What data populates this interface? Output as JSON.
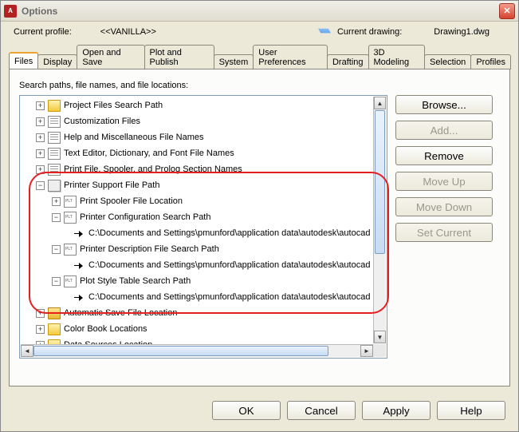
{
  "window": {
    "title": "Options"
  },
  "profile": {
    "label": "Current profile:",
    "value": "<<VANILLA>>"
  },
  "drawing": {
    "label": "Current drawing:",
    "value": "Drawing1.dwg"
  },
  "tabs": [
    "Files",
    "Display",
    "Open and Save",
    "Plot and Publish",
    "System",
    "User Preferences",
    "Drafting",
    "3D Modeling",
    "Selection",
    "Profiles"
  ],
  "panel_caption": "Search paths, file names, and file locations:",
  "tree": {
    "n0": "Project Files Search Path",
    "n1": "Customization Files",
    "n2": "Help and Miscellaneous File Names",
    "n3": "Text Editor, Dictionary, and Font File Names",
    "n4": "Print File, Spooler, and Prolog Section Names",
    "n5": "Printer Support File Path",
    "n5a": "Print Spooler File Location",
    "n5b": "Printer Configuration Search Path",
    "n5b1": "C:\\Documents and Settings\\pmunford\\application data\\autodesk\\autocad",
    "n5c": "Printer Description File Search Path",
    "n5c1": "C:\\Documents and Settings\\pmunford\\application data\\autodesk\\autocad",
    "n5d": "Plot Style Table Search Path",
    "n5d1": "C:\\Documents and Settings\\pmunford\\application data\\autodesk\\autocad",
    "n6": "Automatic Save File Location",
    "n7": "Color Book Locations",
    "n8": "Data Sources Location"
  },
  "buttons": {
    "browse": "Browse...",
    "add": "Add...",
    "remove": "Remove",
    "moveup": "Move Up",
    "movedown": "Move Down",
    "setcurrent": "Set Current"
  },
  "dlg": {
    "ok": "OK",
    "cancel": "Cancel",
    "apply": "Apply",
    "help": "Help"
  }
}
